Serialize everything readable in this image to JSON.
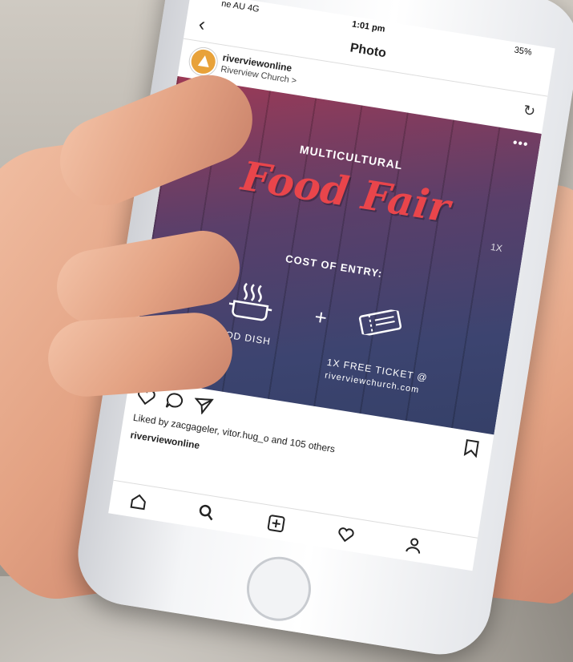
{
  "status_bar": {
    "carrier": "ne AU  4G",
    "time": "1:01 pm",
    "battery": "35%"
  },
  "nav": {
    "back_icon": "chevron-left-icon",
    "title": "Photo"
  },
  "post": {
    "username": "riverviewonline",
    "location": "Riverview Church >",
    "refresh_icon": "refresh-icon",
    "more_icon": "more-dots-icon"
  },
  "poster": {
    "multicultural": "MULTICULTURAL",
    "headline": "Food Fair",
    "cost": "COST OF ENTRY:",
    "plus": "+",
    "dish_label": "1X FOOD DISH",
    "ticket_label": "1X FREE TICKET @",
    "ticket_url": "riverviewchurch.com",
    "x_left": "1X",
    "x_right": "1X",
    "accent_color": "#e9454b"
  },
  "engagement": {
    "likes_text": "Liked by zacgageler, vitor.hug_o and 105 others",
    "caption_user": "riverviewonline"
  },
  "icons": {
    "like": "heart-icon",
    "comment": "comment-icon",
    "share": "send-icon",
    "bookmark": "bookmark-icon",
    "tabs": [
      "home-icon",
      "search-icon",
      "add-icon",
      "activity-heart-icon",
      "profile-icon"
    ]
  }
}
